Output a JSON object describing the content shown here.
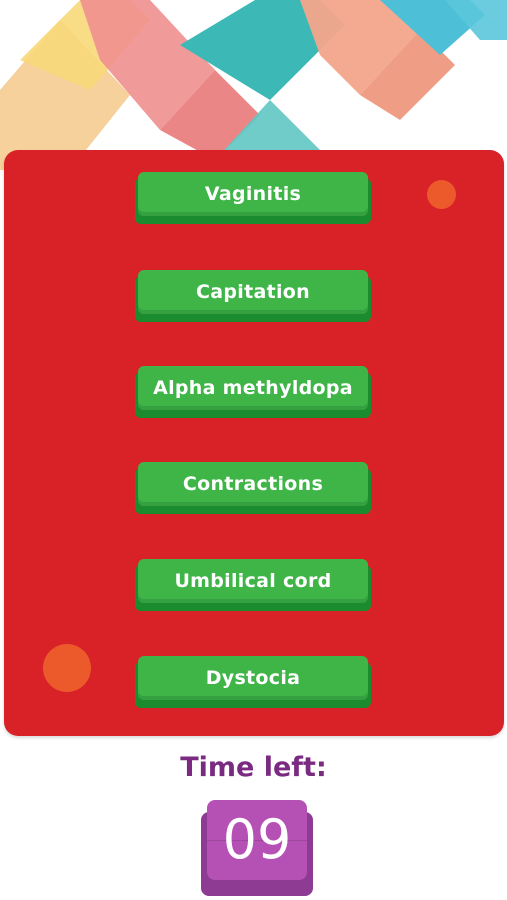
{
  "options": [
    {
      "label": "Vaginitis"
    },
    {
      "label": "Capitation"
    },
    {
      "label": "Alpha methyldopa"
    },
    {
      "label": "Contractions"
    },
    {
      "label": "Umbilical cord"
    },
    {
      "label": "Dystocia"
    }
  ],
  "timer": {
    "label": "Time left:",
    "value": "09"
  },
  "colors": {
    "card_bg": "#d82227",
    "button_face": "#3fb548",
    "button_shadow": "#1a8b2f",
    "accent_dot": "#ec5a2c",
    "timer_label": "#7b2a82",
    "timer_box": "#b550b5"
  }
}
